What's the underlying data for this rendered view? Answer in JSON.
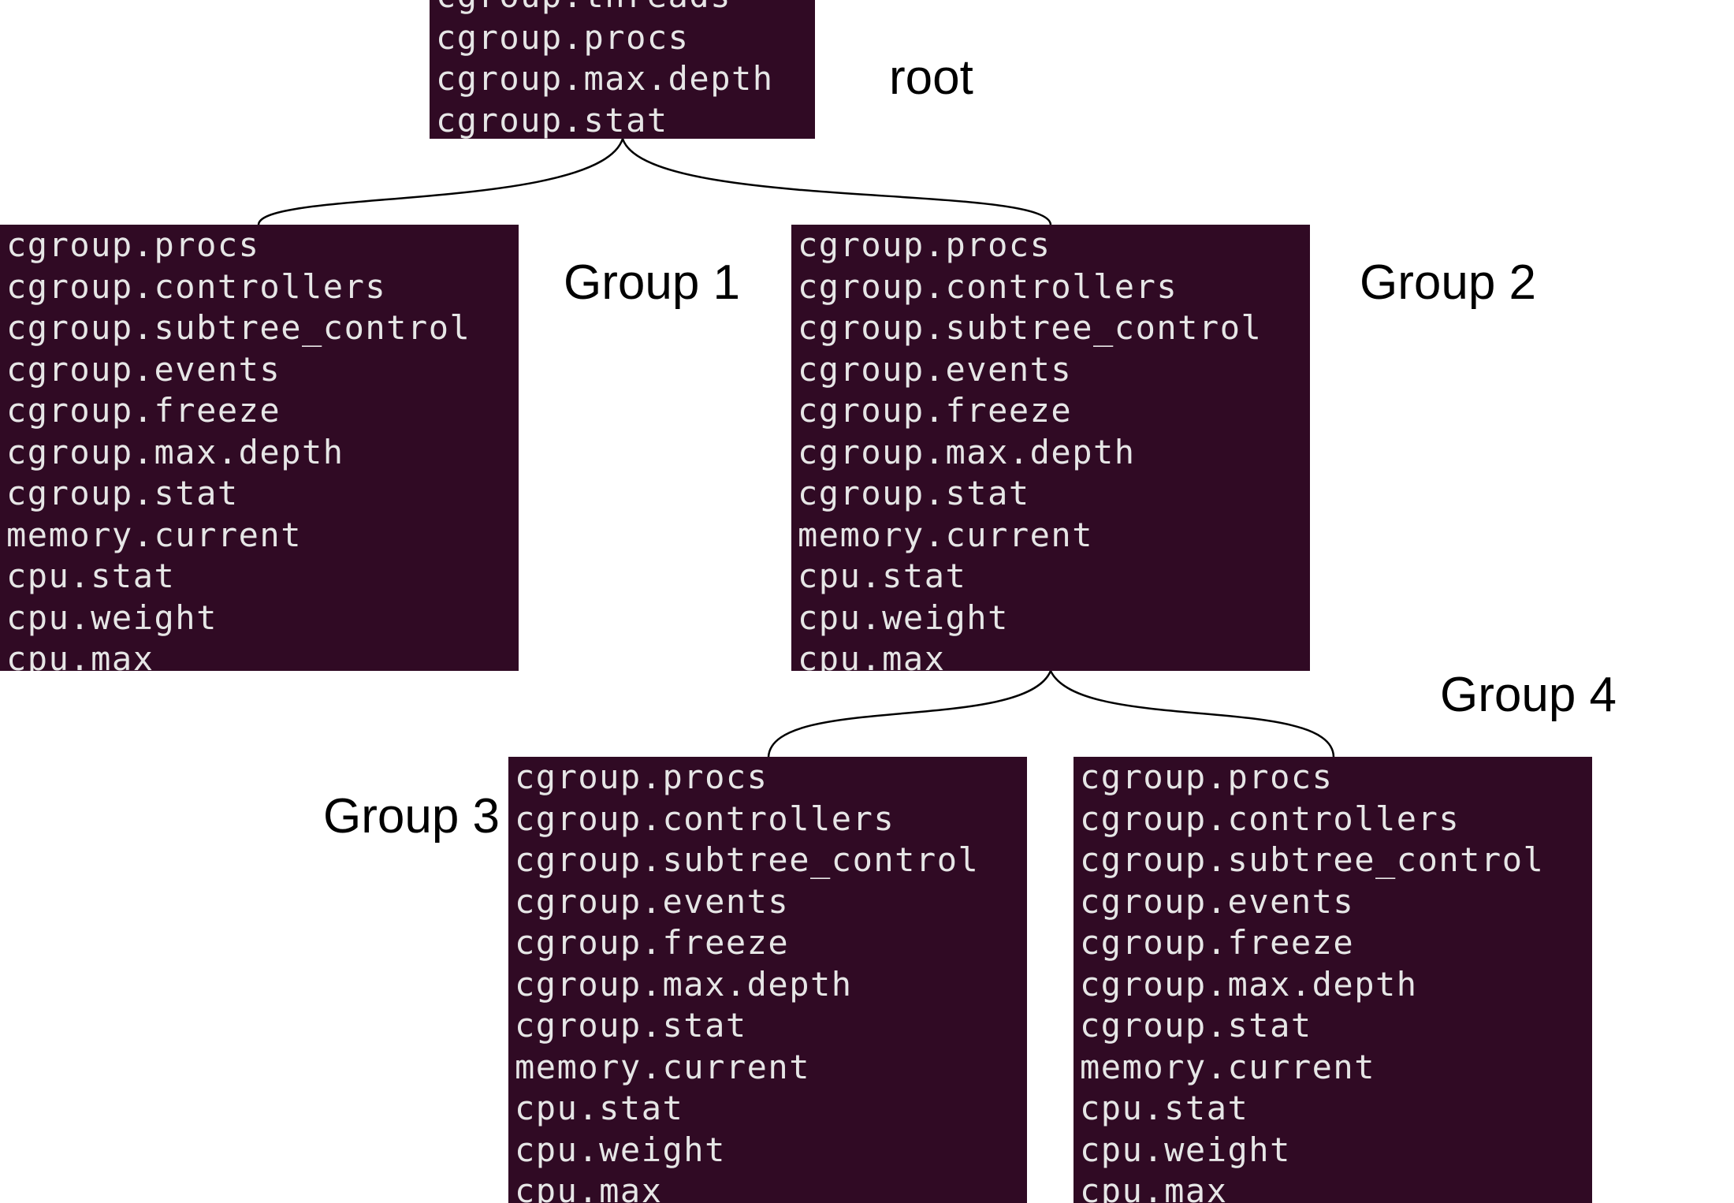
{
  "root": {
    "label": "root",
    "lines": [
      "cgroup.threads",
      "cgroup.procs",
      "cgroup.max.depth",
      "cgroup.stat"
    ]
  },
  "groups": [
    {
      "label": "Group 1",
      "lines": [
        "cgroup.procs",
        "cgroup.controllers",
        "cgroup.subtree_control",
        "cgroup.events",
        "cgroup.freeze",
        "cgroup.max.depth",
        "cgroup.stat",
        "memory.current",
        "cpu.stat",
        "cpu.weight",
        "cpu.max"
      ]
    },
    {
      "label": "Group 2",
      "lines": [
        "cgroup.procs",
        "cgroup.controllers",
        "cgroup.subtree_control",
        "cgroup.events",
        "cgroup.freeze",
        "cgroup.max.depth",
        "cgroup.stat",
        "memory.current",
        "cpu.stat",
        "cpu.weight",
        "cpu.max"
      ]
    },
    {
      "label": "Group 3",
      "lines": [
        "cgroup.procs",
        "cgroup.controllers",
        "cgroup.subtree_control",
        "cgroup.events",
        "cgroup.freeze",
        "cgroup.max.depth",
        "cgroup.stat",
        "memory.current",
        "cpu.stat",
        "cpu.weight",
        "cpu.max"
      ]
    },
    {
      "label": "Group 4",
      "lines": [
        "cgroup.procs",
        "cgroup.controllers",
        "cgroup.subtree_control",
        "cgroup.events",
        "cgroup.freeze",
        "cgroup.max.depth",
        "cgroup.stat",
        "memory.current",
        "cpu.stat",
        "cpu.weight",
        "cpu.max"
      ]
    }
  ],
  "colors": {
    "terminal_background": "#300a24",
    "terminal_text": "#e6e6e6",
    "connector": "#000000",
    "label_text": "#000000"
  }
}
